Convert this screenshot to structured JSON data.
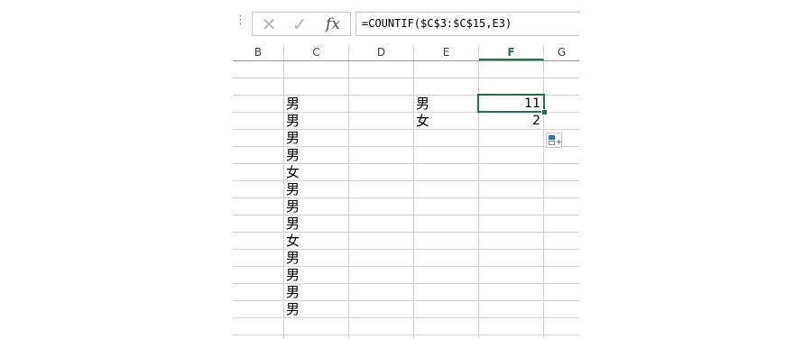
{
  "formula_bar": {
    "cancel_icon": "close-icon",
    "enter_icon": "check-icon",
    "fx_label": "fx",
    "formula": "=COUNTIF($C$3:$C$15,E3)"
  },
  "columns": [
    "B",
    "C",
    "D",
    "E",
    "F",
    "G"
  ],
  "selected_column": "F",
  "column_c_values": [
    "男",
    "男",
    "男",
    "男",
    "女",
    "男",
    "男",
    "男",
    "女",
    "男",
    "男",
    "男",
    "男"
  ],
  "criteria": [
    "男",
    "女"
  ],
  "results": [
    "11",
    "2"
  ],
  "accent_color": "#217346"
}
